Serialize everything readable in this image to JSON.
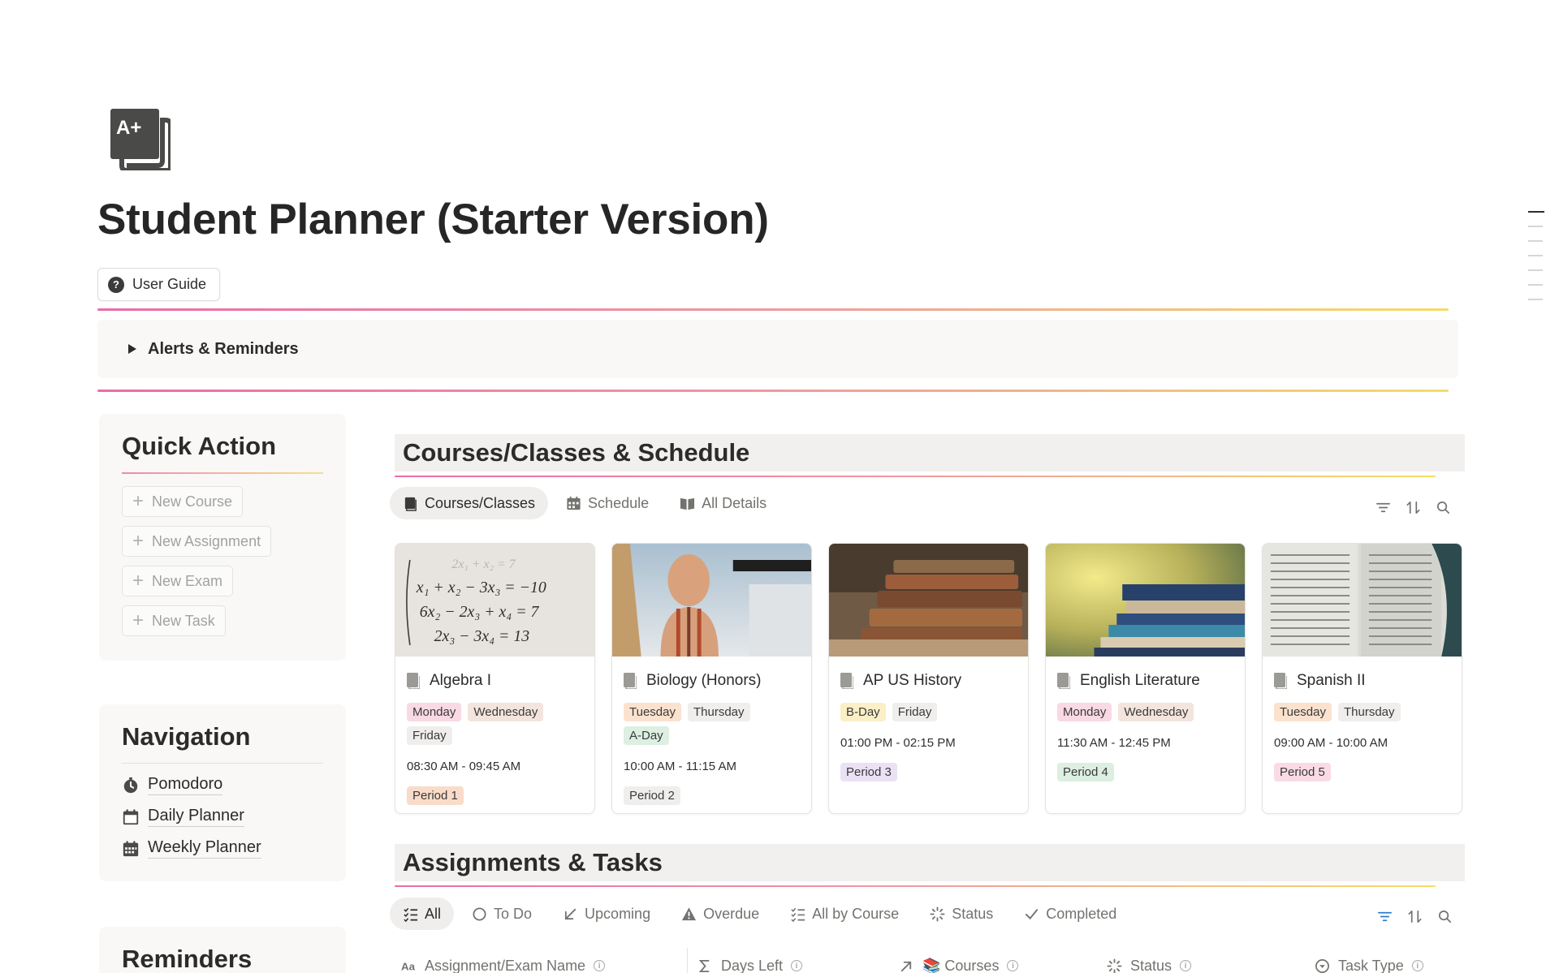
{
  "page": {
    "title": "Student Planner (Starter Version)",
    "icon": "grade-a-plus-icon"
  },
  "user_guide": {
    "label": "User Guide"
  },
  "alerts": {
    "label": "Alerts & Reminders"
  },
  "quick_action": {
    "title": "Quick Action",
    "buttons": [
      "New Course",
      "New Assignment",
      "New Exam",
      "New Task"
    ]
  },
  "navigation": {
    "title": "Navigation",
    "items": [
      {
        "label": "Pomodoro",
        "icon": "timer-icon"
      },
      {
        "label": "Daily Planner",
        "icon": "calendar-day-icon"
      },
      {
        "label": "Weekly Planner",
        "icon": "calendar-week-icon"
      }
    ]
  },
  "reminders": {
    "title": "Reminders"
  },
  "courses": {
    "title": "Courses/Classes & Schedule",
    "tabs": [
      "Courses/Classes",
      "Schedule",
      "All Details"
    ],
    "items": [
      {
        "name": "Algebra I",
        "days": [
          {
            "t": "Monday",
            "c": "#f9d9e4"
          },
          {
            "t": "Wednesday",
            "c": "#f3e4de"
          },
          {
            "t": "Friday",
            "c": "#efeeec"
          }
        ],
        "time": "08:30 AM - 09:45 AM",
        "period": {
          "t": "Period 1",
          "c": "#f8dcc9"
        }
      },
      {
        "name": "Biology (Honors)",
        "days": [
          {
            "t": "Tuesday",
            "c": "#fbe2cf"
          },
          {
            "t": "Thursday",
            "c": "#efeeec"
          },
          {
            "t": "A-Day",
            "c": "#dcefe1"
          }
        ],
        "time": "10:00 AM - 11:15 AM",
        "period": {
          "t": "Period 2",
          "c": "#efeeec"
        }
      },
      {
        "name": "AP US History",
        "days": [
          {
            "t": "B-Day",
            "c": "#fbefc6"
          },
          {
            "t": "Friday",
            "c": "#efeeec"
          }
        ],
        "time": "01:00 PM - 02:15 PM",
        "period": {
          "t": "Period 3",
          "c": "#ebe1f5"
        }
      },
      {
        "name": "English Literature",
        "days": [
          {
            "t": "Monday",
            "c": "#f9d9e4"
          },
          {
            "t": "Wednesday",
            "c": "#f3e4de"
          }
        ],
        "time": "11:30 AM - 12:45 PM",
        "period": {
          "t": "Period 4",
          "c": "#dcefe1"
        }
      },
      {
        "name": "Spanish II",
        "days": [
          {
            "t": "Tuesday",
            "c": "#fbe2cf"
          },
          {
            "t": "Thursday",
            "c": "#efeeec"
          }
        ],
        "time": "09:00 AM - 10:00 AM",
        "period": {
          "t": "Period 5",
          "c": "#fadbe5"
        }
      }
    ]
  },
  "assignments": {
    "title": "Assignments & Tasks",
    "tabs": [
      "All",
      "To Do",
      "Upcoming",
      "Overdue",
      "All by Course",
      "Status",
      "Completed"
    ],
    "columns": [
      "Assignment/Exam Name",
      "Days Left",
      "📚 Courses",
      "Status",
      "Task Type"
    ]
  }
}
